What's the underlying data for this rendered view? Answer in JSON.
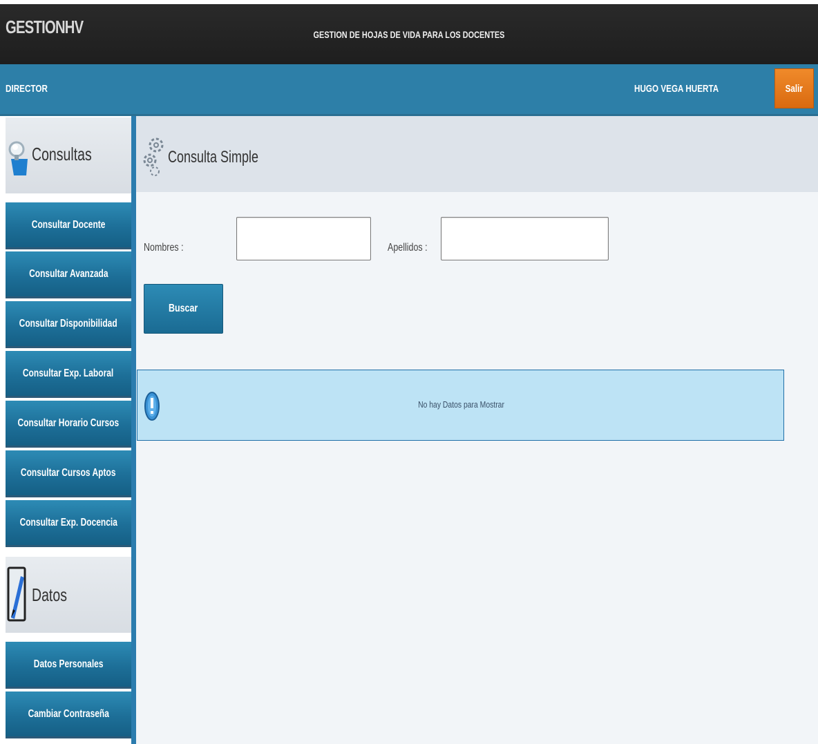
{
  "header": {
    "brand": "GESTIONHV",
    "title": "GESTION DE HOJAS DE VIDA PARA LOS DOCENTES"
  },
  "userbar": {
    "role": "DIRECTOR",
    "user_name": "HUGO VEGA HUERTA",
    "logout_label": "Salir"
  },
  "sidebar": {
    "consultas": {
      "label": "Consultas",
      "icon": "magnifier-icon",
      "items": [
        {
          "label": "Consultar Docente"
        },
        {
          "label": "Consultar Avanzada"
        },
        {
          "label": "Consultar Disponibilidad"
        },
        {
          "label": "Consultar Exp. Laboral"
        },
        {
          "label": "Consultar Horario Cursos"
        },
        {
          "label": "Consultar Cursos Aptos"
        },
        {
          "label": "Consultar Exp. Docencia"
        }
      ]
    },
    "datos": {
      "label": "Datos",
      "icon": "edit-pencil-icon",
      "items": [
        {
          "label": "Datos Personales"
        },
        {
          "label": "Cambiar Contraseña"
        }
      ]
    }
  },
  "main": {
    "title": "Consulta Simple",
    "icon": "gears-icon",
    "form": {
      "nombres_label": "Nombres :",
      "nombres_value": "",
      "apellidos_label": "Apellidos :",
      "apellidos_value": "",
      "search_label": "Buscar"
    },
    "info": {
      "message": "No hay Datos para Mostrar",
      "icon": "info-exclamation-icon"
    }
  },
  "colors": {
    "header_bg": "#1e1e1e",
    "userbar_bg": "#2d7fa8",
    "accent_orange": "#e9781b",
    "menu_blue": "#1d6f98",
    "info_bg": "#bde3f5"
  }
}
